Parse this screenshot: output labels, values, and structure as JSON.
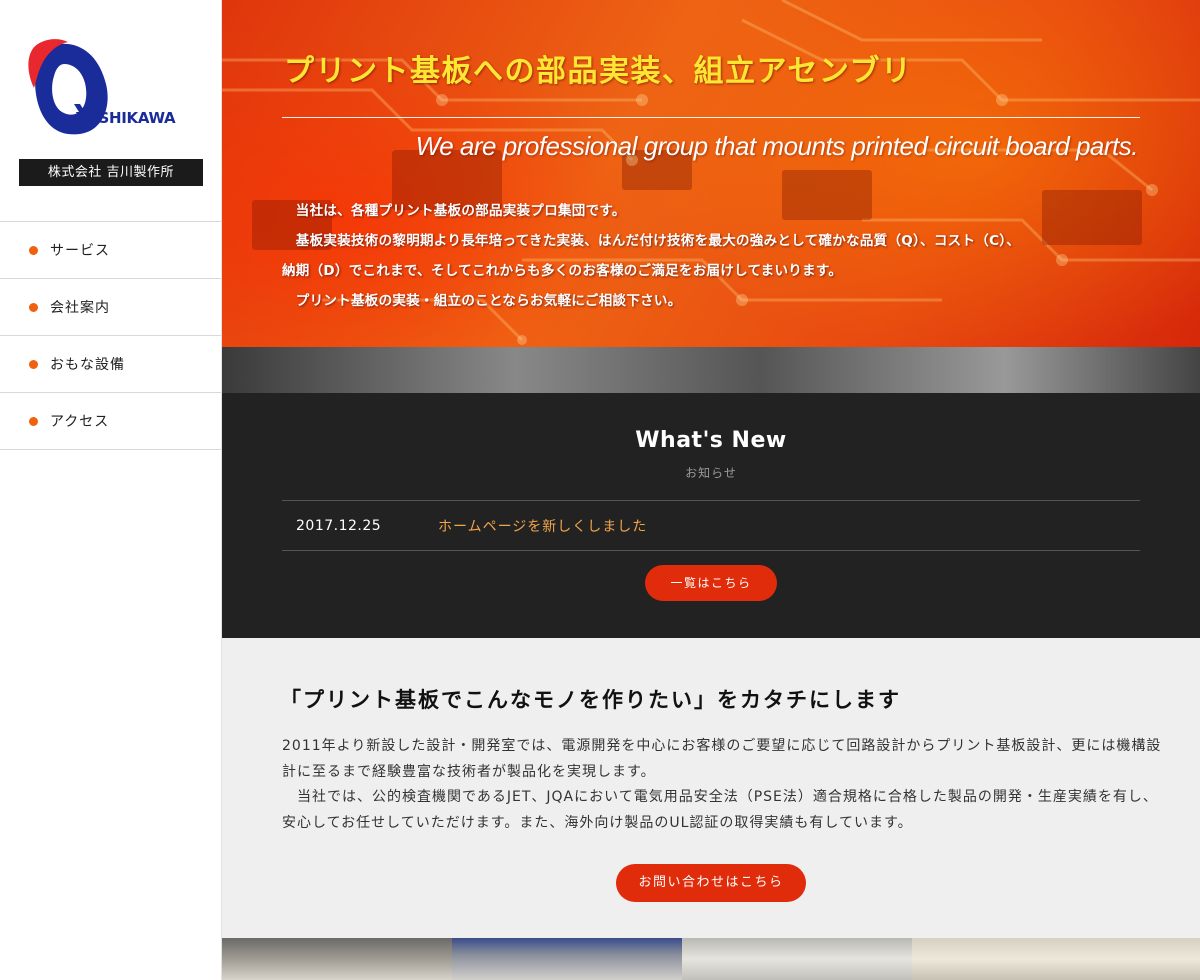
{
  "brand": {
    "logo_text": "YOSHIKAWA",
    "company_name": "株式会社 吉川製作所",
    "colors": {
      "logo_red": "#e8282e",
      "logo_blue": "#1a2b9a"
    }
  },
  "nav": {
    "items": [
      {
        "label": "サービス"
      },
      {
        "label": "会社案内"
      },
      {
        "label": "おもな設備"
      },
      {
        "label": "アクセス"
      }
    ],
    "bullet_color": "#f0600f"
  },
  "hero": {
    "title": "プリント基板への部品実装、組立アセンブリ",
    "subtitle": "We are professional group that mounts printed circuit board parts.",
    "body": [
      "　当社は、各種プリント基板の部品実装プロ集団です。",
      "　基板実装技術の黎明期より長年培ってきた実装、はんだ付け技術を最大の強みとして確かな品質（Q）、コスト（C）、",
      "納期（D）でこれまで、そしてこれからも多くのお客様のご満足をお届けしてまいります。",
      "　プリント基板の実装・組立のことならお気軽にご相談下さい。"
    ]
  },
  "news": {
    "title": "What's New",
    "subtitle": "お知らせ",
    "items": [
      {
        "date": "2017.12.25",
        "text": "ホームページを新しくしました"
      }
    ],
    "more_button": "一覧はこちら"
  },
  "about": {
    "title": "「プリント基板でこんなモノを作りたい」をカタチにします",
    "body": [
      "2011年より新設した設計・開発室では、電源開発を中心にお客様のご要望に応じて回路設計からプリント基板設計、更には機構設計に至るまで経験豊富な技術者が製品化を実現します。",
      "　当社では、公的検査機関であるJET、JQAにおいて電気用品安全法（PSE法）適合規格に合格した製品の開発・生産実績を有し、安心してお任せしていただけます。また、海外向け製品のUL認証の取得実績も有しています。"
    ],
    "contact_button": "お問い合わせはこちら"
  },
  "accent_color": "#e02c0a"
}
